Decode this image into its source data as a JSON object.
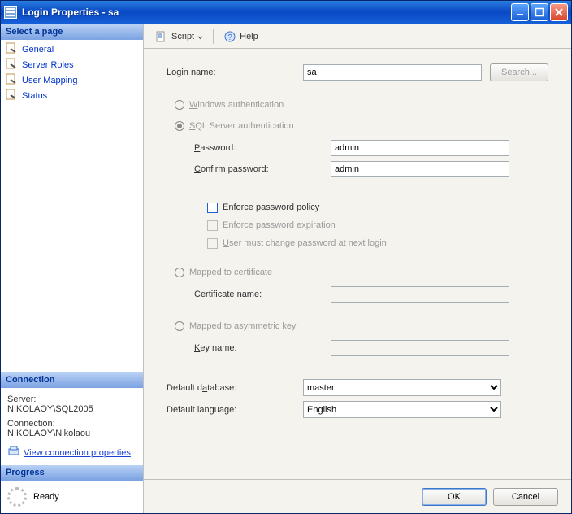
{
  "window": {
    "title": "Login Properties - sa"
  },
  "left": {
    "select_page": "Select a page",
    "nav": [
      "General",
      "Server Roles",
      "User Mapping",
      "Status"
    ],
    "connection_header": "Connection",
    "server_label": "Server:",
    "server_value": "NIKOLAOY\\SQL2005",
    "connection_label": "Connection:",
    "connection_value": "NIKOLAOY\\Nikolaou",
    "view_connection": "View connection properties",
    "progress_header": "Progress",
    "progress_status": "Ready"
  },
  "toolbar": {
    "script": "Script",
    "help": "Help"
  },
  "form": {
    "login_name_label": "Login name:",
    "login_name_value": "sa",
    "search_btn": "Search...",
    "win_auth": "Windows authentication",
    "sql_auth": "SQL Server authentication",
    "password_label": "Password:",
    "password_value": "admin",
    "confirm_label": "Confirm password:",
    "confirm_value": "admin",
    "enforce_policy": "Enforce password policy",
    "enforce_expiration": "Enforce password expiration",
    "must_change": "User must change password at next login",
    "mapped_cert": "Mapped to certificate",
    "cert_name_label": "Certificate name:",
    "mapped_asym": "Mapped to asymmetric key",
    "key_name_label": "Key name:",
    "default_db_label": "Default database:",
    "default_db_value": "master",
    "default_lang_label": "Default language:",
    "default_lang_value": "English"
  },
  "footer": {
    "ok": "OK",
    "cancel": "Cancel"
  }
}
